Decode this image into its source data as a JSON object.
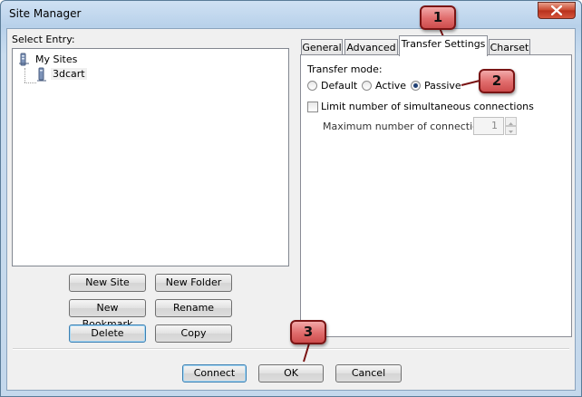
{
  "window": {
    "title": "Site Manager"
  },
  "tree": {
    "heading": "Select Entry:",
    "root": {
      "label": "My Sites",
      "icon": "folder-icon"
    },
    "child": {
      "label": "3dcart",
      "icon": "server-icon"
    }
  },
  "buttons": {
    "new_site": "New Site",
    "new_folder": "New Folder",
    "new_bookmark": "New Bookmark",
    "rename": "Rename",
    "delete": "Delete",
    "copy": "Copy",
    "connect": "Connect",
    "ok": "OK",
    "cancel": "Cancel"
  },
  "tabs": [
    {
      "label": "General"
    },
    {
      "label": "Advanced"
    },
    {
      "label": "Transfer Settings",
      "active": true
    },
    {
      "label": "Charset"
    }
  ],
  "transfer": {
    "mode_label": "Transfer mode:",
    "modes": [
      "Default",
      "Active",
      "Passive"
    ],
    "selected_mode": "Passive",
    "limit_label": "Limit number of simultaneous connections",
    "limit_checked": false,
    "max_label": "Maximum number of connections:",
    "max_value": "1"
  },
  "callouts": [
    "1",
    "2",
    "3"
  ],
  "colors": {
    "callout_fill": "#e06b6b",
    "callout_border": "#7a1414",
    "title_bar": "#b8d1ea",
    "close_button": "#c8452c"
  }
}
